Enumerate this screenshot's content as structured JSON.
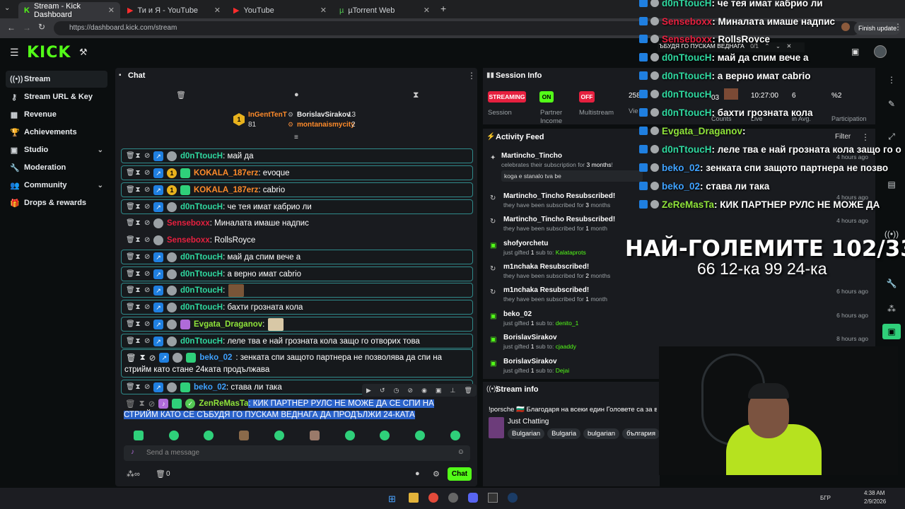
{
  "browser": {
    "tabs": [
      {
        "label": "Stream - Kick Dashboard",
        "active": true
      },
      {
        "label": "Ти и Я - YouTube",
        "active": false
      },
      {
        "label": "YouTube",
        "active": false
      },
      {
        "label": "µTorrent Web",
        "active": false
      }
    ],
    "url": "https://dashboard.kick.com/stream",
    "finish_update": "Finish update"
  },
  "header": {
    "logo": "KICK"
  },
  "sidebar": {
    "items": [
      {
        "label": "Stream",
        "icon": "broadcast-icon",
        "glyph": "((•))",
        "active": true
      },
      {
        "label": "Stream URL & Key",
        "icon": "key-icon",
        "glyph": "⚷"
      },
      {
        "label": "Revenue",
        "icon": "revenue-icon",
        "glyph": "▦"
      },
      {
        "label": "Achievements",
        "icon": "trophy-icon",
        "glyph": "🏆"
      },
      {
        "label": "Studio",
        "icon": "studio-icon",
        "glyph": "▣",
        "chevron": true
      },
      {
        "label": "Moderation",
        "icon": "wrench-icon",
        "glyph": "🔧"
      },
      {
        "label": "Community",
        "icon": "community-icon",
        "glyph": "👥",
        "chevron": true
      },
      {
        "label": "Drops & rewards",
        "icon": "gift-icon",
        "glyph": "🎁"
      }
    ]
  },
  "chat": {
    "title": "Chat",
    "top_gifters": [
      {
        "name": "InGentTenT",
        "count": "81"
      },
      {
        "name": "BorislavSirakov",
        "count": "13"
      },
      {
        "name": "montanaismycity",
        "count": "2"
      }
    ],
    "messages": [
      {
        "user": "d0nTtoucH",
        "color": "u-teal",
        "text": ": май да",
        "badges": [
          "kick",
          "av"
        ]
      },
      {
        "user": "KOKALA_187erz",
        "color": "u-orange",
        "text": ": evoque",
        "badges": [
          "kick",
          "gold",
          "gift"
        ]
      },
      {
        "user": "KOKALA_187erz",
        "color": "u-orange",
        "text": ": cabrio",
        "badges": [
          "kick",
          "gold",
          "gift"
        ]
      },
      {
        "user": "d0nTtoucH",
        "color": "u-teal",
        "text": ": че тея имат кабрио ли",
        "badges": [
          "kick",
          "av"
        ]
      },
      {
        "user": "Senseboxx",
        "color": "u-red",
        "text": ": Миналата имаше надпис",
        "badges": [
          "av"
        ],
        "plain": true
      },
      {
        "user": "Senseboxx",
        "color": "u-red",
        "text": ": RollsRoyce",
        "badges": [
          "av"
        ],
        "plain": true
      },
      {
        "user": "d0nTtoucH",
        "color": "u-teal",
        "text": ": май да спим вече а",
        "badges": [
          "kick",
          "av"
        ]
      },
      {
        "user": "d0nTtoucH",
        "color": "u-teal",
        "text": ": а верно имат cabrio",
        "badges": [
          "kick",
          "av"
        ]
      },
      {
        "user": "d0nTtoucH",
        "color": "u-teal",
        "text": ":",
        "badges": [
          "kick",
          "av"
        ],
        "emote": "face"
      },
      {
        "user": "d0nTtoucH",
        "color": "u-teal",
        "text": ": бахти грозната кола",
        "badges": [
          "kick",
          "av"
        ]
      },
      {
        "user": "Evgata_Draganov",
        "color": "u-lime",
        "text": ":",
        "badges": [
          "kick",
          "av",
          "purple"
        ],
        "emote": "cat"
      },
      {
        "user": "d0nTtoucH",
        "color": "u-teal",
        "text": ": леле тва е най грозната кола защо го отворих това",
        "badges": [
          "kick",
          "av"
        ]
      }
    ],
    "beko_long": {
      "user": "beko_02",
      "text1": ": зенката спи защото партнера не позволява да спи на",
      "text2": "стрийм като стане 24ката продължава"
    },
    "beko_short": {
      "user": "beko_02",
      "text": ": става ли така"
    },
    "selected": {
      "user": "ZenReMasTa",
      "text1": ": КИК ПАРТНЕР РУЛС НЕ МОЖЕ ДА СЕ СПИ НА",
      "text2": "СТРИЙМ КАТО СЕ СЪБУДЯ ГО ПУСКАМ ВЕДНАГА ДА ПРОДЪЛЖИ 24-КАТА"
    },
    "input_placeholder": "Send a message",
    "footer_count": "0",
    "chat_button": "Chat"
  },
  "session": {
    "title": "Session Info",
    "streaming": "STREAMING",
    "on": "ON",
    "off": "OFF",
    "session_label": "Session",
    "partner_label": "Partner Income",
    "multistream_label": "Multistream",
    "viewers_value": "258",
    "viewers_label": "Vie"
  },
  "activity": {
    "title": "Activity Feed",
    "filter": "Filter",
    "items": [
      {
        "title": "Martincho_Tincho",
        "sub_pre": "celebrates their subscription for ",
        "sub_bold": "3 months",
        "sub_post": "!",
        "time": "4 hours ago",
        "quote": "koga e stanalo tva be",
        "icon": "celebrate-icon"
      },
      {
        "title": "Martincho_Tincho Resubscribed!",
        "sub_pre": "they have been subscribed for ",
        "sub_bold": "3",
        "sub_post": " months",
        "time": "4 hours ago",
        "icon": "resub-icon"
      },
      {
        "title": "Martincho_Tincho Resubscribed!",
        "sub_pre": "they have been subscribed for ",
        "sub_bold": "1",
        "sub_post": " month",
        "time": "4 hours ago",
        "icon": "resub-icon"
      },
      {
        "title": "shofyorchetu",
        "sub_pre": "just gifted ",
        "sub_bold": "1",
        "sub_post": " sub to: ",
        "target": "Kalataprots",
        "time": "",
        "icon": "gift-icon"
      },
      {
        "title": "m1nchaka Resubscribed!",
        "sub_pre": "they have been subscribed for ",
        "sub_bold": "2",
        "sub_post": " months",
        "time": "",
        "icon": "resub-icon"
      },
      {
        "title": "m1nchaka Resubscribed!",
        "sub_pre": "they have been subscribed for ",
        "sub_bold": "1",
        "sub_post": " month",
        "time": "6 hours ago",
        "icon": "resub-icon"
      },
      {
        "title": "beko_02",
        "sub_pre": "just gifted ",
        "sub_bold": "1",
        "sub_post": " sub to: ",
        "target": "denito_1",
        "time": "6 hours ago",
        "icon": "gift-icon"
      },
      {
        "title": "BorislavSirakov",
        "sub_pre": "just gifted ",
        "sub_bold": "1",
        "sub_post": " sub to: ",
        "target": "cjaaddy",
        "time": "8 hours ago",
        "icon": "gift-icon"
      },
      {
        "title": "BorislavSirakov",
        "sub_pre": "just gifted ",
        "sub_bold": "1",
        "sub_post": " sub to: ",
        "target": "Dejai",
        "time": "",
        "icon": "gift-icon"
      }
    ]
  },
  "stream_info": {
    "title": "Stream info",
    "stream_title": "!porsche 🇧🇬 Благодаря на всеки един Головете са за в",
    "category": "Just Chatting",
    "tags": [
      "Bulgarian",
      "Bulgaria",
      "bulgarian",
      "българия"
    ]
  },
  "overlay": {
    "lines": [
      {
        "user": "d0nTtoucH",
        "text": ": че тея имат кабрио ли",
        "color": "#2fd9a0"
      },
      {
        "user": "Senseboxx",
        "text": ": Миналата имаше надпис",
        "color": "#e6203f"
      },
      {
        "user": "Senseboxx",
        "text": ": RollsRoyce",
        "color": "#e6203f"
      },
      {
        "user": "d0nTtoucH",
        "text": ": май да спим вече а",
        "color": "#2fd9a0"
      },
      {
        "user": "d0nTtoucH",
        "text": ": а верно имат cabrio",
        "color": "#2fd9a0"
      },
      {
        "user": "d0nTtoucH",
        "text": "",
        "color": "#2fd9a0"
      },
      {
        "user": "d0nTtoucH",
        "text": ": бахти грозната кола",
        "color": "#2fd9a0"
      },
      {
        "user": "Evgata_Draganov",
        "text": ":",
        "color": "#8fe33a"
      },
      {
        "user": "d0nTtoucH",
        "text": ": леле тва е най грозната кола защо го о",
        "color": "#2fd9a0"
      },
      {
        "user": "beko_02",
        "text": ": зенката спи защото партнера не позво",
        "color": "#3fa2ff"
      },
      {
        "user": "beko_02",
        "text": ": става ли така",
        "color": "#3fa2ff"
      },
      {
        "user": "ZeRеMasTa",
        "text": ": КИК ПАРТНЕР РУЛС НЕ МОЖЕ ДА",
        "color": "#8fe33a"
      }
    ],
    "popup_text": "ЪБУДЯ ГО ПУСКАМ ВЕДНАГА",
    "popup_count": "0/1",
    "big_title": "НАЙ-ГОЛЕМИТЕ 102/33",
    "big_sub": "66 12-ка 99 24-ка",
    "stat_time": "10:27:00",
    "stat_six": "6",
    "stat_pct": "%2",
    "stat_03": "03",
    "counts_label": "Counts",
    "live_label": "Live",
    "avg_label": "in Avg.",
    "participation_label": "Participation"
  },
  "taskbar": {
    "time": "4:38 AM",
    "date": "2/9/2026",
    "lang": "БГР"
  }
}
